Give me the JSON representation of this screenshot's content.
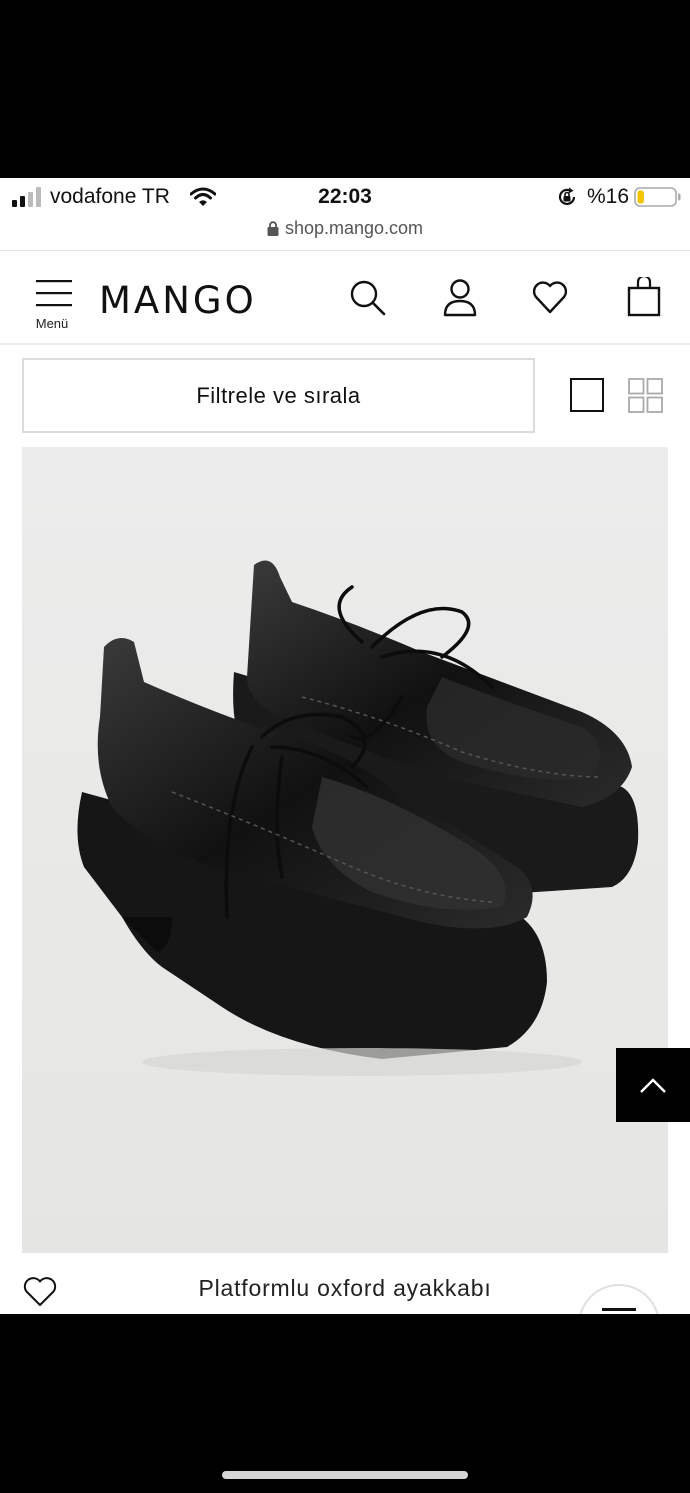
{
  "status_bar": {
    "carrier": "vodafone TR",
    "time": "22:03",
    "battery_percent": "%16",
    "battery_level": 0.16,
    "icons": [
      "signal-icon",
      "wifi-icon",
      "rotation-lock-icon",
      "battery-icon"
    ]
  },
  "browser": {
    "url": "shop.mango.com"
  },
  "header": {
    "menu_label": "Menü",
    "logo": "MANGO",
    "icons": [
      "search-icon",
      "user-icon",
      "heart-icon",
      "shopping-bag-icon"
    ]
  },
  "toolbar": {
    "filter_label": "Filtrele ve sırala",
    "view_options": [
      "single-column-view-icon",
      "grid-view-icon"
    ]
  },
  "product": {
    "name": "Platformlu oxford ayakkabı",
    "image": "black-platform-oxford-shoes",
    "colors": {
      "accent": "#000000",
      "image_background": "#ebebeb"
    }
  }
}
